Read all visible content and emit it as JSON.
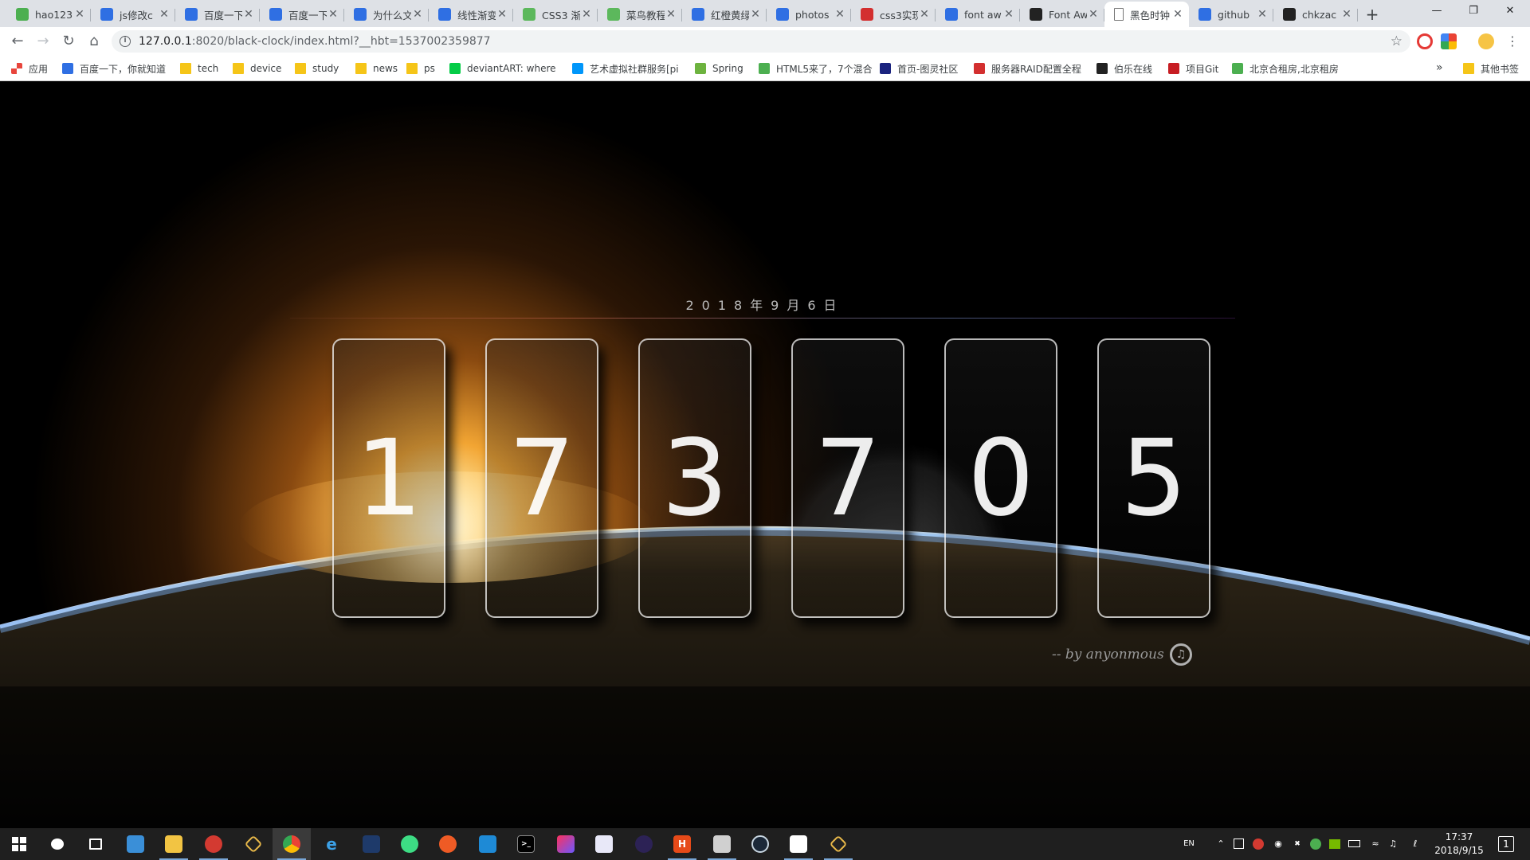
{
  "tabs": [
    {
      "title": "hao123",
      "icon": "hao123-icon",
      "color": "#4caf50"
    },
    {
      "title": "js修改c",
      "icon": "baidu-paw-icon",
      "color": "#2f6fe3"
    },
    {
      "title": "百度一下",
      "icon": "baidu-paw-icon",
      "color": "#2f6fe3"
    },
    {
      "title": "百度一下",
      "icon": "baidu-paw-icon",
      "color": "#2f6fe3"
    },
    {
      "title": "为什么文",
      "icon": "baidu-paw-icon",
      "color": "#2f6fe3"
    },
    {
      "title": "线性渐变",
      "icon": "baidu-paw-icon",
      "color": "#2f6fe3"
    },
    {
      "title": "CSS3 渐",
      "icon": "runoob-icon",
      "color": "#5cb85c"
    },
    {
      "title": "菜鸟教程",
      "icon": "runoob-icon",
      "color": "#5cb85c"
    },
    {
      "title": "红橙黄绿",
      "icon": "baidu-paw-icon",
      "color": "#2f6fe3"
    },
    {
      "title": "photos",
      "icon": "baidu-paw-icon",
      "color": "#2f6fe3"
    },
    {
      "title": "css3实现",
      "icon": "csdn-icon",
      "color": "#d32f2f"
    },
    {
      "title": "font aw",
      "icon": "baidu-paw-icon",
      "color": "#2f6fe3"
    },
    {
      "title": "Font Aw",
      "icon": "flag-icon",
      "color": "#222222"
    },
    {
      "title": "黑色时钟",
      "icon": "page-icon",
      "color": "#888888",
      "active": true
    },
    {
      "title": "github",
      "icon": "baidu-paw-icon",
      "color": "#2f6fe3"
    },
    {
      "title": "chkzac",
      "icon": "github-icon",
      "color": "#222222"
    }
  ],
  "toolbar": {
    "url_host": "127.0.0.1",
    "url_path": ":8020/black-clock/index.html?__hbt=1537002359877"
  },
  "bookmarks": [
    {
      "label": "应用",
      "icon": "apps-grid-icon",
      "color": "#e8453c"
    },
    {
      "label": "百度一下，你就知道",
      "icon": "baidu-paw-icon",
      "color": "#2f6fe3"
    },
    {
      "label": "tech",
      "icon": "folder-icon",
      "color": "#f5c518"
    },
    {
      "label": "device",
      "icon": "folder-icon",
      "color": "#f5c518"
    },
    {
      "label": "study",
      "icon": "folder-icon",
      "color": "#f5c518"
    },
    {
      "label": "news",
      "icon": "folder-icon",
      "color": "#f5c518"
    },
    {
      "label": "ps",
      "icon": "folder-icon",
      "color": "#f5c518"
    },
    {
      "label": "deviantART: where",
      "icon": "deviantart-icon",
      "color": "#05cc47"
    },
    {
      "label": "艺术虚拟社群服务[pi",
      "icon": "pixiv-icon",
      "color": "#0096fa"
    },
    {
      "label": "Spring",
      "icon": "spring-icon",
      "color": "#6db33f"
    },
    {
      "label": "HTML5来了，7个混合",
      "icon": "leaf-icon",
      "color": "#4caf50"
    },
    {
      "label": "首页-图灵社区",
      "icon": "turing-icon",
      "color": "#1a237e"
    },
    {
      "label": "服务器RAID配置全程",
      "icon": "csdn-icon",
      "color": "#d32f2f"
    },
    {
      "label": "伯乐在线",
      "icon": "github-icon",
      "color": "#222222"
    },
    {
      "label": "项目Git",
      "icon": "gitee-icon",
      "color": "#c71d23"
    },
    {
      "label": "北京合租房,北京租房",
      "icon": "ziroom-icon",
      "color": "#4caf50"
    }
  ],
  "bookmarks_more": "»",
  "other_bookmarks": "其他书签",
  "clock_page": {
    "date": "2018年9月6日",
    "digits": [
      "1",
      "7",
      "3",
      "7",
      "0",
      "5"
    ],
    "author": "-- by anyonmous"
  },
  "taskbar": {
    "lang": "EN",
    "time": "17:37",
    "date": "2018/9/15",
    "notification_count": "1"
  }
}
